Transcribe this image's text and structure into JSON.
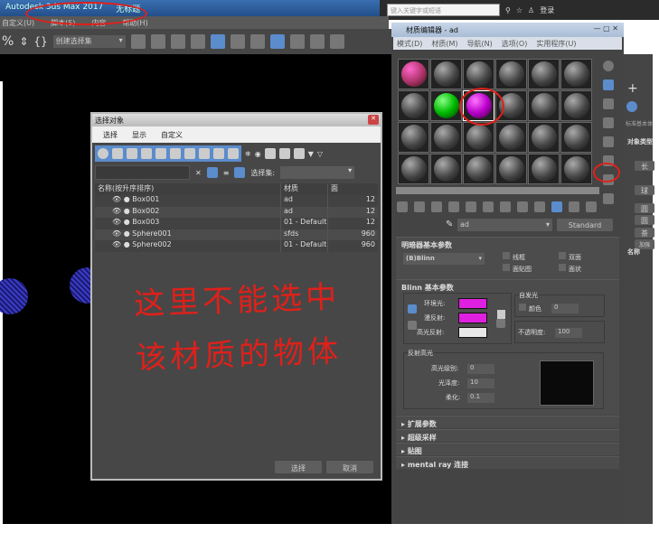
{
  "app": {
    "title": "Autodesk 3ds Max 2017",
    "doc": "无标题",
    "search_placeholder": "键入关键字或短语",
    "login": "登录"
  },
  "menu": [
    "自定义(U)",
    "脚本(S)",
    "内容",
    "帮助(H)"
  ],
  "toolbar": {
    "selection_set": "创建选择集"
  },
  "select_dialog": {
    "title": "选择对象",
    "menu": [
      "选择",
      "显示",
      "自定义"
    ],
    "selset_label": "选择集:",
    "columns": [
      "名称(按升序排序)",
      "材质",
      "面"
    ],
    "rows": [
      {
        "name": "Box001",
        "material": "ad",
        "faces": "12"
      },
      {
        "name": "Box002",
        "material": "ad",
        "faces": "12"
      },
      {
        "name": "Box003",
        "material": "01 - Default",
        "faces": "12"
      },
      {
        "name": "Sphere001",
        "material": "sfds",
        "faces": "960"
      },
      {
        "name": "Sphere002",
        "material": "01 - Default",
        "faces": "960"
      }
    ],
    "ok": "选择",
    "cancel": "取消"
  },
  "material_editor": {
    "title": "材质编辑器 - ad",
    "menu": [
      "模式(D)",
      "材质(M)",
      "导航(N)",
      "选项(O)",
      "实用程序(U)"
    ],
    "material_name": "ad",
    "material_type": "Standard",
    "shader_rollout": "明暗器基本参数",
    "shader": "(B)Blinn",
    "wire": "线框",
    "two_sided": "双面",
    "face_map": "面贴图",
    "faceted": "面状",
    "blinn_rollout": "Blinn 基本参数",
    "ambient": "环境光:",
    "diffuse": "漫反射:",
    "specular": "高光反射:",
    "self_illum": "自发光",
    "color": "颜色",
    "self_illum_val": "0",
    "opacity_label": "不透明度:",
    "opacity": "100",
    "spec_group": "反射高光",
    "spec_level_label": "高光级别:",
    "spec_level": "0",
    "gloss_label": "光泽度:",
    "gloss": "10",
    "soften_label": "柔化:",
    "soften": "0.1",
    "rollouts": [
      "扩展参数",
      "超级采样",
      "贴图",
      "mental ray 连接"
    ],
    "colors": {
      "ambient": "#e020e0",
      "diffuse": "#e020e0",
      "specular": "#e8e8e8"
    }
  },
  "command_panel": {
    "labels": [
      "标准基本体",
      "对象类型",
      "长",
      "球",
      "圆",
      "圆",
      "茶",
      "加强",
      "名称"
    ]
  },
  "annotation": {
    "line1": "这里不能选中",
    "line2": "该材质的物体"
  }
}
